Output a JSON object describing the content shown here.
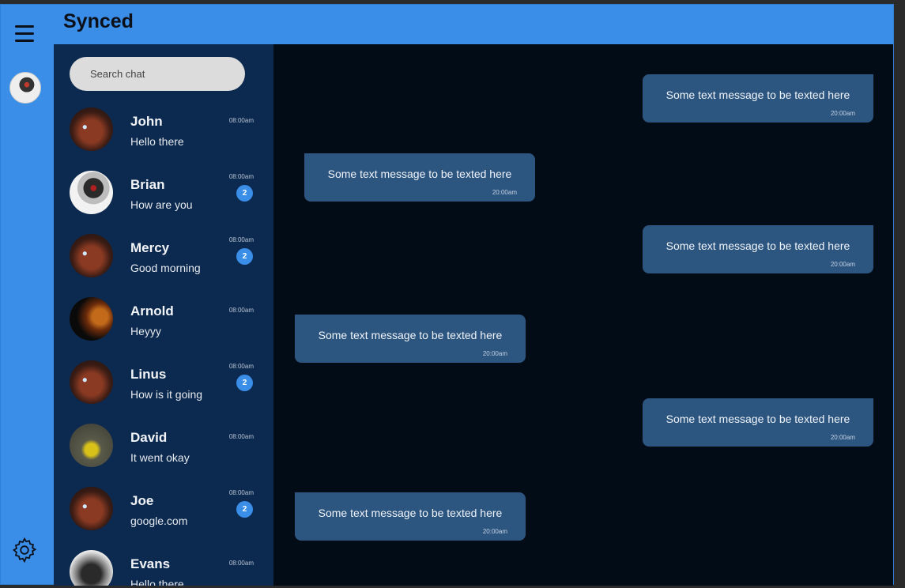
{
  "app": {
    "title": "Synced"
  },
  "search": {
    "placeholder": "Search chat"
  },
  "icons": {
    "menu": "hamburger-menu-icon",
    "settings": "gear-icon"
  },
  "colors": {
    "accent": "#3a8ee8",
    "sidebar": "#0c2a4f",
    "chat_bg": "#020c17",
    "bubble": "#2c5580"
  },
  "chats": [
    {
      "name": "John",
      "preview": "Hello there",
      "time": "08:00am",
      "unread": ""
    },
    {
      "name": "Brian",
      "preview": "How are you",
      "time": "08:00am",
      "unread": "2"
    },
    {
      "name": "Mercy",
      "preview": "Good morning",
      "time": "08:00am",
      "unread": "2"
    },
    {
      "name": "Arnold",
      "preview": "Heyyy",
      "time": "08:00am",
      "unread": ""
    },
    {
      "name": "Linus",
      "preview": "How is it going",
      "time": "08:00am",
      "unread": "2"
    },
    {
      "name": "David",
      "preview": "It went okay",
      "time": "08:00am",
      "unread": ""
    },
    {
      "name": "Joe",
      "preview": "google.com",
      "time": "08:00am",
      "unread": "2"
    },
    {
      "name": "Evans",
      "preview": "Hello there",
      "time": "08:00am",
      "unread": ""
    }
  ],
  "messages": [
    {
      "text": "Some text message to be texted here",
      "time": "20:00am",
      "direction": "outgoing"
    },
    {
      "text": "Some text message to be texted here",
      "time": "20:00am",
      "direction": "incoming"
    },
    {
      "text": "Some text message to be texted here",
      "time": "20:00am",
      "direction": "outgoing"
    },
    {
      "text": "Some text message to be texted here",
      "time": "20:00am",
      "direction": "incoming"
    },
    {
      "text": "Some text message to be texted here",
      "time": "20:00am",
      "direction": "outgoing"
    },
    {
      "text": "Some text message to be texted here",
      "time": "20:00am",
      "direction": "incoming"
    }
  ]
}
